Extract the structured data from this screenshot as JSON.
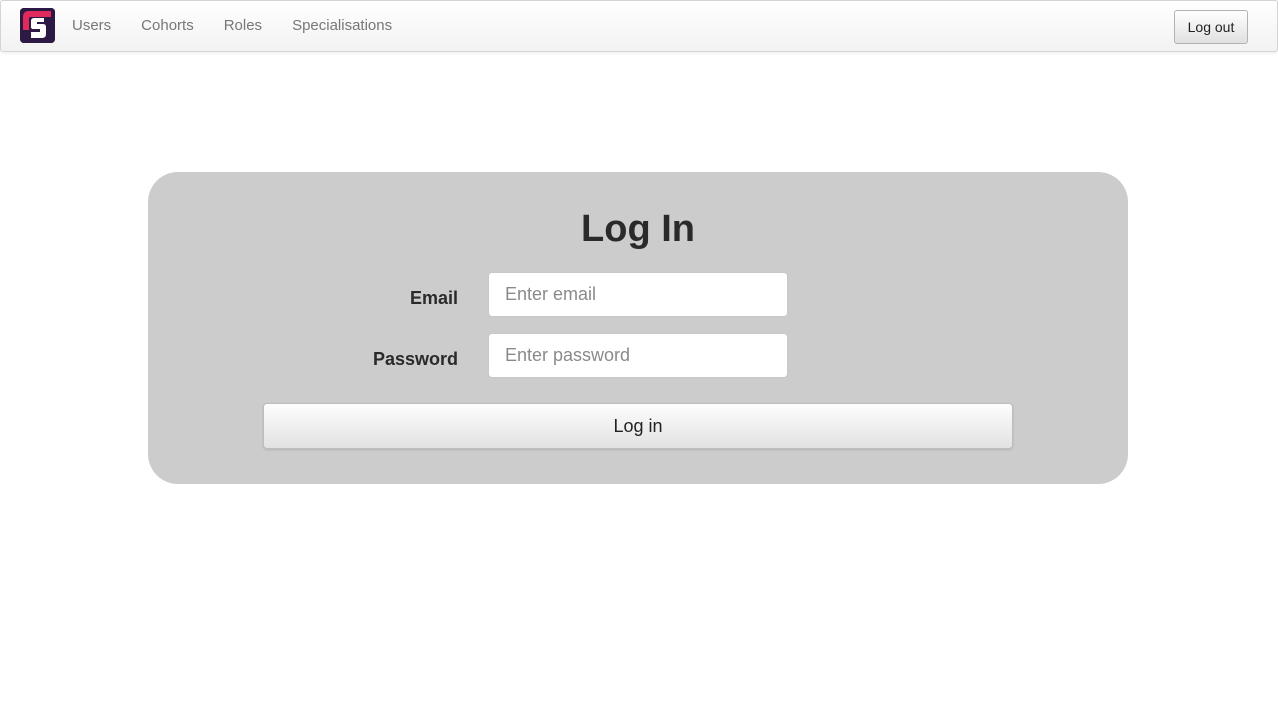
{
  "navbar": {
    "logo": {
      "icon": "app-logo-icon",
      "letter": "S",
      "colors": {
        "background": "#2d1a44",
        "accent": "#e02a5c"
      }
    },
    "links": [
      {
        "label": "Users"
      },
      {
        "label": "Cohorts"
      },
      {
        "label": "Roles"
      },
      {
        "label": "Specialisations"
      }
    ],
    "logout_label": "Log out"
  },
  "login": {
    "title": "Log In",
    "email_label": "Email",
    "email_placeholder": "Enter email",
    "email_value": "",
    "password_label": "Password",
    "password_placeholder": "Enter password",
    "password_value": "",
    "submit_label": "Log in"
  },
  "colors": {
    "panel_background": "#cccccc",
    "page_background": "#ffffff"
  }
}
